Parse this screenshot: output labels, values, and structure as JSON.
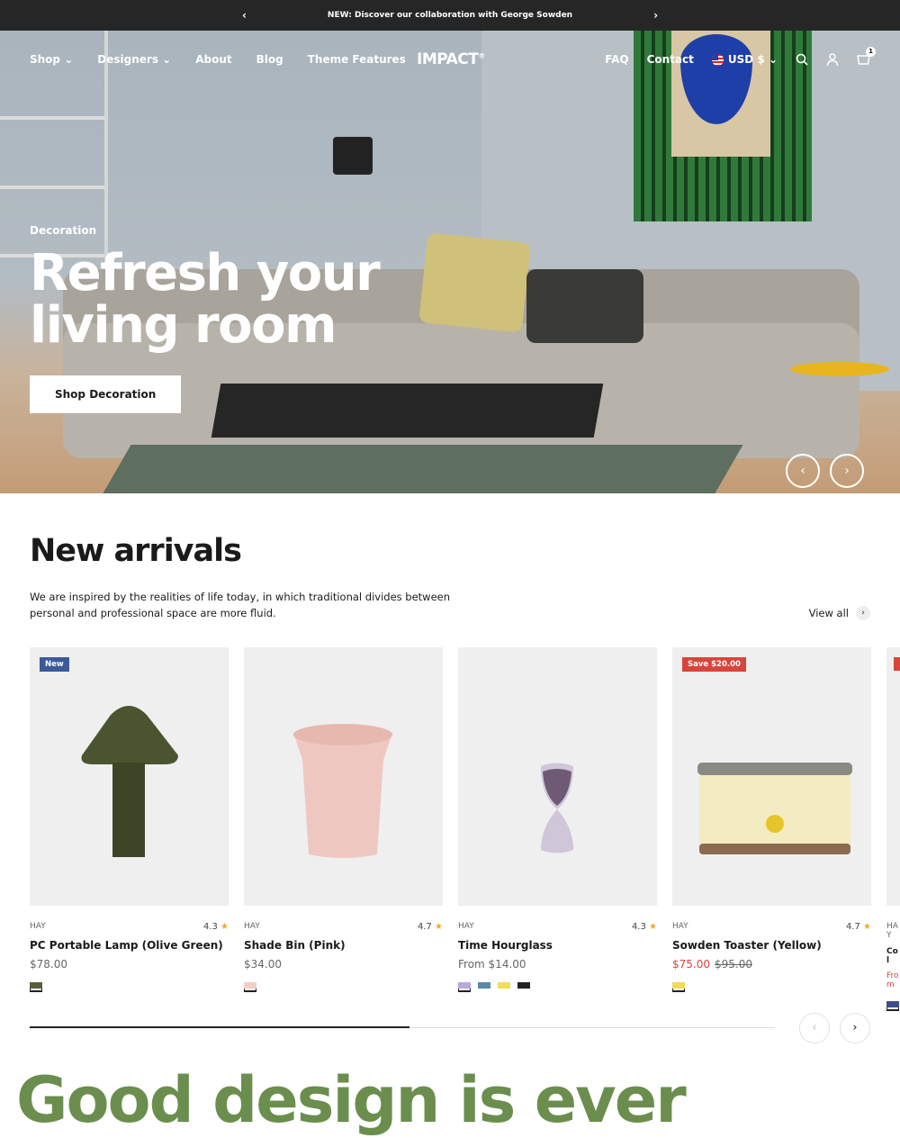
{
  "announcement": {
    "text": "NEW: Discover our collaboration with George Sowden",
    "prev": "‹",
    "next": "›"
  },
  "nav": {
    "left": [
      "Shop",
      "Designers",
      "About",
      "Blog",
      "Theme Features"
    ],
    "logo": "IMPACT",
    "logo_mark": "®",
    "right": [
      "FAQ",
      "Contact"
    ],
    "currency": "USD $",
    "cart_count": "1"
  },
  "hero": {
    "subheading": "Decoration",
    "title": "Refresh your living room",
    "button": "Shop Decoration",
    "prev": "‹",
    "next": "›"
  },
  "section": {
    "title": "New arrivals",
    "description": "We are inspired by the realities of life today, in which traditional divides between personal and professional space are more fluid.",
    "view_all": "View all"
  },
  "products": [
    {
      "badge": "New",
      "badge_color": "#3a5a9b",
      "vendor": "HAY",
      "rating": "4.3",
      "name": "PC Portable Lamp (Olive Green)",
      "price": "$78.00",
      "swatches": [
        "#5a5e3a"
      ]
    },
    {
      "vendor": "HAY",
      "rating": "4.7",
      "name": "Shade Bin (Pink)",
      "price": "$34.00",
      "swatches": [
        "#f1cfc4"
      ]
    },
    {
      "vendor": "HAY",
      "rating": "4.3",
      "name": "Time Hourglass",
      "price": "From $14.00",
      "swatches": [
        "#b8a9d6",
        "#5a88a8",
        "#f0dc5a",
        "#222222"
      ]
    },
    {
      "badge": "Save $20.00",
      "badge_color": "#d9453b",
      "vendor": "HAY",
      "rating": "4.7",
      "name": "Sowden Toaster (Yellow)",
      "sale_price": "$75.00",
      "compare_price": "$95.00",
      "swatches": [
        "#f0dc5a"
      ]
    },
    {
      "vendor": "HAY",
      "name": "Col",
      "price": "From",
      "swatches": [
        "#3a4e8a"
      ]
    }
  ],
  "carousel": {
    "progress_percent": 51,
    "prev": "‹",
    "next": "›"
  },
  "tagline": "Good design is ever"
}
